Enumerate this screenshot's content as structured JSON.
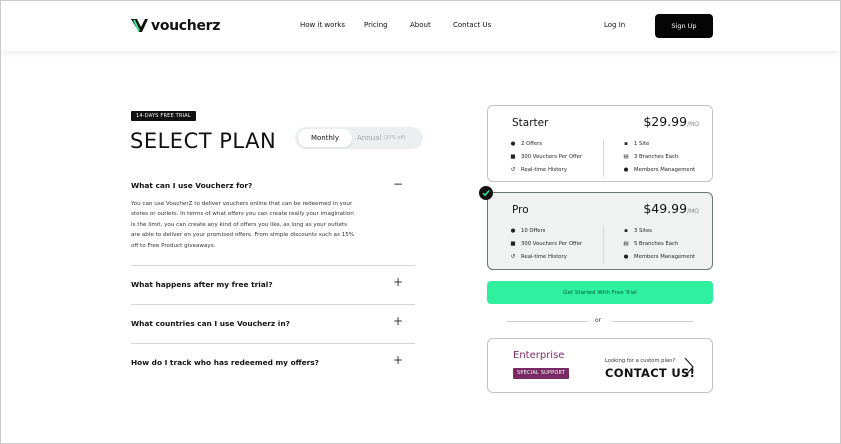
{
  "brand": {
    "name": "voucherz"
  },
  "nav": {
    "items": [
      "How it works",
      "Pricing",
      "About",
      "Contact Us"
    ],
    "login": "Log In",
    "signup": "Sign Up"
  },
  "trial_badge": "14-DAYS FREE TRIAL",
  "title": "SELECT PLAN",
  "billing_toggle": {
    "monthly": "Monthly",
    "annual": "Annual",
    "annual_discount": "(20% off)",
    "selected": "Monthly"
  },
  "faq": [
    {
      "question": "What can I use Voucherz for?",
      "expanded": true,
      "answer": [
        "You can use VoucherZ to deliver vouchers online that can be redeemed in your",
        "stores or outlets. In terms of what offers you can create really your imagination",
        "is the limit, you can create any kind of offers you like, as long as your outlets",
        "are able to deliver on your promised offers. From simple discounts such as 15%",
        "off to Free Product giveaways."
      ],
      "toggle": "−"
    },
    {
      "question": "What happens after my free trial?",
      "expanded": false,
      "toggle": "+"
    },
    {
      "question": "What countries can I use Voucherz in?",
      "expanded": false,
      "toggle": "+"
    },
    {
      "question": "How do I track who has redeemed my offers?",
      "expanded": false,
      "toggle": "+"
    }
  ],
  "plans": [
    {
      "name": "Starter",
      "price": "$29.99",
      "period": "/MO",
      "selected": false,
      "features_left": [
        {
          "icon": "offer-icon",
          "text": "2 Offers"
        },
        {
          "icon": "voucher-icon",
          "text": "300 Vouchers Per Offer"
        },
        {
          "icon": "history-icon",
          "text": "Real-time History"
        }
      ],
      "features_right": [
        {
          "icon": "site-icon",
          "text": "1 Site"
        },
        {
          "icon": "branch-icon",
          "text": "3 Branches Each"
        },
        {
          "icon": "members-icon",
          "text": "Members Management"
        }
      ]
    },
    {
      "name": "Pro",
      "price": "$49.99",
      "period": "/MO",
      "selected": true,
      "features_left": [
        {
          "icon": "offer-icon",
          "text": "10 Offers"
        },
        {
          "icon": "voucher-icon",
          "text": "300 Vouchers Per Offer"
        },
        {
          "icon": "history-icon",
          "text": "Real-time History"
        }
      ],
      "features_right": [
        {
          "icon": "site-icon",
          "text": "3 Sites"
        },
        {
          "icon": "branch-icon",
          "text": "5 Branches Each"
        },
        {
          "icon": "members-icon",
          "text": "Members Management"
        }
      ]
    }
  ],
  "cta": "Get Started With Free Trial",
  "or_text": "or",
  "enterprise": {
    "name": "Enterprise",
    "badge": "SPECIAL SUPPORT",
    "ask": "Looking for a custom plan?",
    "contact": "CONTACT US!"
  },
  "colors": {
    "cta_green": "#2ef09f",
    "enterprise_purple": "#7a2b66",
    "dark": "#050505"
  }
}
